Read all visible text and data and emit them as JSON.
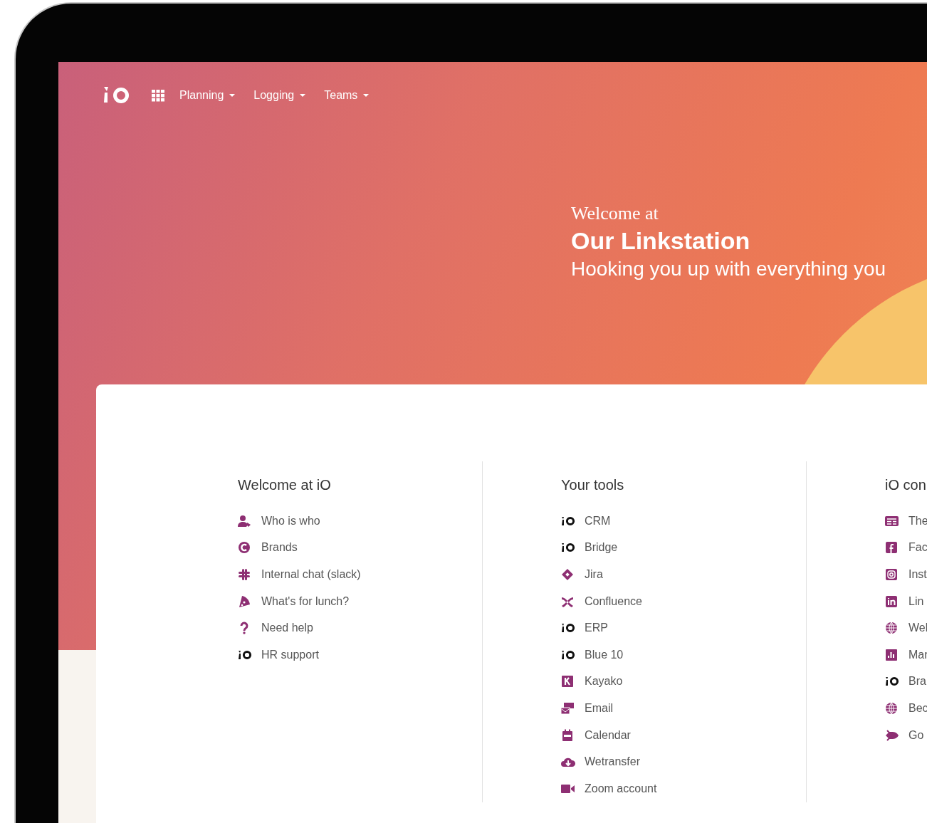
{
  "nav": {
    "menus": [
      {
        "label": "Planning"
      },
      {
        "label": "Logging"
      },
      {
        "label": "Teams"
      }
    ]
  },
  "hero": {
    "eyebrow": "Welcome at",
    "title": "Our Linkstation",
    "subtitle": "Hooking you up with everything you"
  },
  "columns": [
    {
      "heading": "Welcome at iO",
      "links": [
        "Who is who",
        "Brands",
        "Internal chat (slack)",
        "What's for lunch?",
        "Need help",
        "HR support"
      ]
    },
    {
      "heading": "Your tools",
      "links": [
        "CRM",
        "Bridge",
        "Jira",
        "Confluence",
        "ERP",
        "Blue 10",
        "Kayako",
        "Email",
        "Calendar",
        "Wetransfer",
        "Zoom account"
      ]
    },
    {
      "heading": "iO con",
      "links": [
        "The",
        "Fac",
        "Inst",
        "Lin",
        "Wel",
        "Mar",
        "Bra",
        "Bec",
        "Go"
      ]
    }
  ]
}
